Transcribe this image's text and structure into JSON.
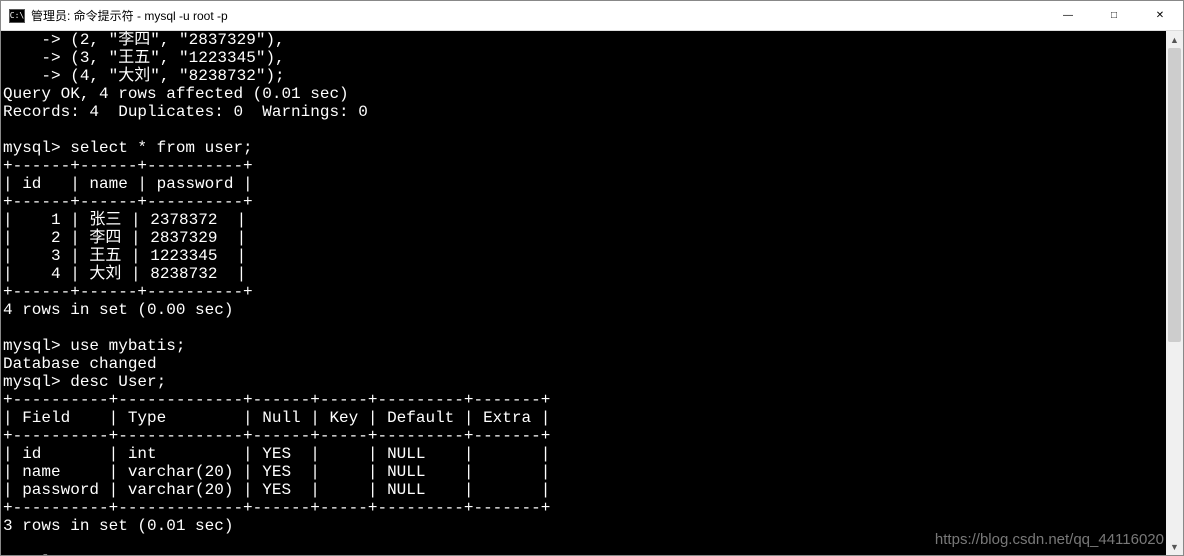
{
  "window": {
    "title": "管理员: 命令提示符 - mysql  -u root -p",
    "icon_label": "C:\\",
    "controls": {
      "minimize": "—",
      "maximize": "□",
      "close": "✕"
    }
  },
  "scrollbar": {
    "up": "▲",
    "down": "▼"
  },
  "terminal": {
    "insert_lines": [
      "    -> (2, \"李四\", \"2837329\"),",
      "    -> (3, \"王五\", \"1223345\"),",
      "    -> (4, \"大刘\", \"8238732\");"
    ],
    "query_ok": "Query OK, 4 rows affected (0.01 sec)",
    "records_line": "Records: 4  Duplicates: 0  Warnings: 0",
    "prompt": "mysql>",
    "select_cmd": "select * from user;",
    "user_table": {
      "border_top": "+------+------+----------+",
      "header": "| id   | name | password |",
      "border_mid": "+------+------+----------+",
      "rows": [
        "|    1 | 张三 | 2378372  |",
        "|    2 | 李四 | 2837329  |",
        "|    3 | 王五 | 1223345  |",
        "|    4 | 大刘 | 8238732  |"
      ],
      "border_bot": "+------+------+----------+",
      "summary": "4 rows in set (0.00 sec)"
    },
    "use_cmd": "use mybatis;",
    "db_changed": "Database changed",
    "desc_cmd": "desc User;",
    "desc_table": {
      "border_top": "+----------+-------------+------+-----+---------+-------+",
      "header": "| Field    | Type        | Null | Key | Default | Extra |",
      "border_mid": "+----------+-------------+------+-----+---------+-------+",
      "rows": [
        "| id       | int         | YES  |     | NULL    |       |",
        "| name     | varchar(20) | YES  |     | NULL    |       |",
        "| password | varchar(20) | YES  |     | NULL    |       |"
      ],
      "border_bot": "+----------+-------------+------+-----+---------+-------+",
      "summary": "3 rows in set (0.01 sec)"
    },
    "final_prompt": "mysql>"
  },
  "watermark": "https://blog.csdn.net/qq_44116020",
  "data_values": {
    "users": [
      {
        "id": 1,
        "name": "张三",
        "password": "2378372"
      },
      {
        "id": 2,
        "name": "李四",
        "password": "2837329"
      },
      {
        "id": 3,
        "name": "王五",
        "password": "1223345"
      },
      {
        "id": 4,
        "name": "大刘",
        "password": "8238732"
      }
    ],
    "schema_User": [
      {
        "Field": "id",
        "Type": "int",
        "Null": "YES",
        "Key": "",
        "Default": "NULL",
        "Extra": ""
      },
      {
        "Field": "name",
        "Type": "varchar(20)",
        "Null": "YES",
        "Key": "",
        "Default": "NULL",
        "Extra": ""
      },
      {
        "Field": "password",
        "Type": "varchar(20)",
        "Null": "YES",
        "Key": "",
        "Default": "NULL",
        "Extra": ""
      }
    ]
  }
}
